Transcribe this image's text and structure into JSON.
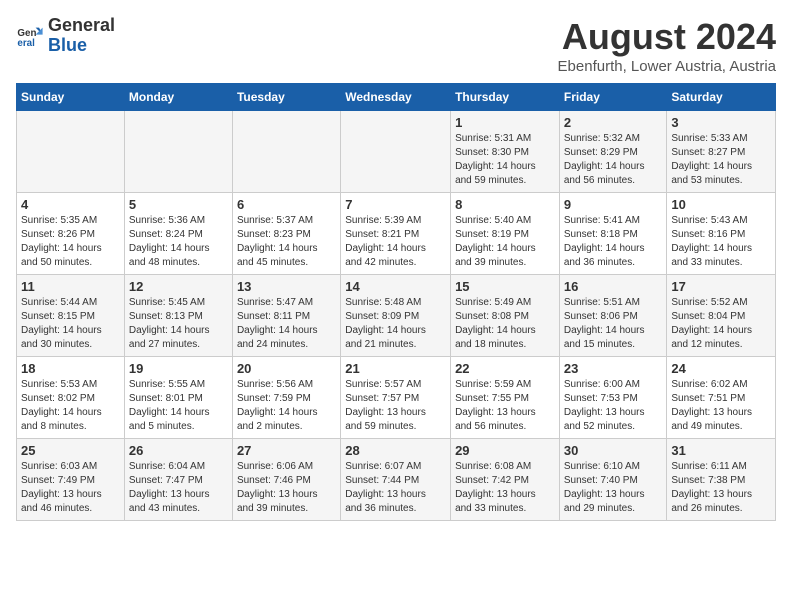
{
  "logo": {
    "general": "General",
    "blue": "Blue"
  },
  "title": "August 2024",
  "subtitle": "Ebenfurth, Lower Austria, Austria",
  "days_of_week": [
    "Sunday",
    "Monday",
    "Tuesday",
    "Wednesday",
    "Thursday",
    "Friday",
    "Saturday"
  ],
  "weeks": [
    [
      {
        "day": "",
        "info": ""
      },
      {
        "day": "",
        "info": ""
      },
      {
        "day": "",
        "info": ""
      },
      {
        "day": "",
        "info": ""
      },
      {
        "day": "1",
        "info": "Sunrise: 5:31 AM\nSunset: 8:30 PM\nDaylight: 14 hours\nand 59 minutes."
      },
      {
        "day": "2",
        "info": "Sunrise: 5:32 AM\nSunset: 8:29 PM\nDaylight: 14 hours\nand 56 minutes."
      },
      {
        "day": "3",
        "info": "Sunrise: 5:33 AM\nSunset: 8:27 PM\nDaylight: 14 hours\nand 53 minutes."
      }
    ],
    [
      {
        "day": "4",
        "info": "Sunrise: 5:35 AM\nSunset: 8:26 PM\nDaylight: 14 hours\nand 50 minutes."
      },
      {
        "day": "5",
        "info": "Sunrise: 5:36 AM\nSunset: 8:24 PM\nDaylight: 14 hours\nand 48 minutes."
      },
      {
        "day": "6",
        "info": "Sunrise: 5:37 AM\nSunset: 8:23 PM\nDaylight: 14 hours\nand 45 minutes."
      },
      {
        "day": "7",
        "info": "Sunrise: 5:39 AM\nSunset: 8:21 PM\nDaylight: 14 hours\nand 42 minutes."
      },
      {
        "day": "8",
        "info": "Sunrise: 5:40 AM\nSunset: 8:19 PM\nDaylight: 14 hours\nand 39 minutes."
      },
      {
        "day": "9",
        "info": "Sunrise: 5:41 AM\nSunset: 8:18 PM\nDaylight: 14 hours\nand 36 minutes."
      },
      {
        "day": "10",
        "info": "Sunrise: 5:43 AM\nSunset: 8:16 PM\nDaylight: 14 hours\nand 33 minutes."
      }
    ],
    [
      {
        "day": "11",
        "info": "Sunrise: 5:44 AM\nSunset: 8:15 PM\nDaylight: 14 hours\nand 30 minutes."
      },
      {
        "day": "12",
        "info": "Sunrise: 5:45 AM\nSunset: 8:13 PM\nDaylight: 14 hours\nand 27 minutes."
      },
      {
        "day": "13",
        "info": "Sunrise: 5:47 AM\nSunset: 8:11 PM\nDaylight: 14 hours\nand 24 minutes."
      },
      {
        "day": "14",
        "info": "Sunrise: 5:48 AM\nSunset: 8:09 PM\nDaylight: 14 hours\nand 21 minutes."
      },
      {
        "day": "15",
        "info": "Sunrise: 5:49 AM\nSunset: 8:08 PM\nDaylight: 14 hours\nand 18 minutes."
      },
      {
        "day": "16",
        "info": "Sunrise: 5:51 AM\nSunset: 8:06 PM\nDaylight: 14 hours\nand 15 minutes."
      },
      {
        "day": "17",
        "info": "Sunrise: 5:52 AM\nSunset: 8:04 PM\nDaylight: 14 hours\nand 12 minutes."
      }
    ],
    [
      {
        "day": "18",
        "info": "Sunrise: 5:53 AM\nSunset: 8:02 PM\nDaylight: 14 hours\nand 8 minutes."
      },
      {
        "day": "19",
        "info": "Sunrise: 5:55 AM\nSunset: 8:01 PM\nDaylight: 14 hours\nand 5 minutes."
      },
      {
        "day": "20",
        "info": "Sunrise: 5:56 AM\nSunset: 7:59 PM\nDaylight: 14 hours\nand 2 minutes."
      },
      {
        "day": "21",
        "info": "Sunrise: 5:57 AM\nSunset: 7:57 PM\nDaylight: 13 hours\nand 59 minutes."
      },
      {
        "day": "22",
        "info": "Sunrise: 5:59 AM\nSunset: 7:55 PM\nDaylight: 13 hours\nand 56 minutes."
      },
      {
        "day": "23",
        "info": "Sunrise: 6:00 AM\nSunset: 7:53 PM\nDaylight: 13 hours\nand 52 minutes."
      },
      {
        "day": "24",
        "info": "Sunrise: 6:02 AM\nSunset: 7:51 PM\nDaylight: 13 hours\nand 49 minutes."
      }
    ],
    [
      {
        "day": "25",
        "info": "Sunrise: 6:03 AM\nSunset: 7:49 PM\nDaylight: 13 hours\nand 46 minutes."
      },
      {
        "day": "26",
        "info": "Sunrise: 6:04 AM\nSunset: 7:47 PM\nDaylight: 13 hours\nand 43 minutes."
      },
      {
        "day": "27",
        "info": "Sunrise: 6:06 AM\nSunset: 7:46 PM\nDaylight: 13 hours\nand 39 minutes."
      },
      {
        "day": "28",
        "info": "Sunrise: 6:07 AM\nSunset: 7:44 PM\nDaylight: 13 hours\nand 36 minutes."
      },
      {
        "day": "29",
        "info": "Sunrise: 6:08 AM\nSunset: 7:42 PM\nDaylight: 13 hours\nand 33 minutes."
      },
      {
        "day": "30",
        "info": "Sunrise: 6:10 AM\nSunset: 7:40 PM\nDaylight: 13 hours\nand 29 minutes."
      },
      {
        "day": "31",
        "info": "Sunrise: 6:11 AM\nSunset: 7:38 PM\nDaylight: 13 hours\nand 26 minutes."
      }
    ]
  ]
}
